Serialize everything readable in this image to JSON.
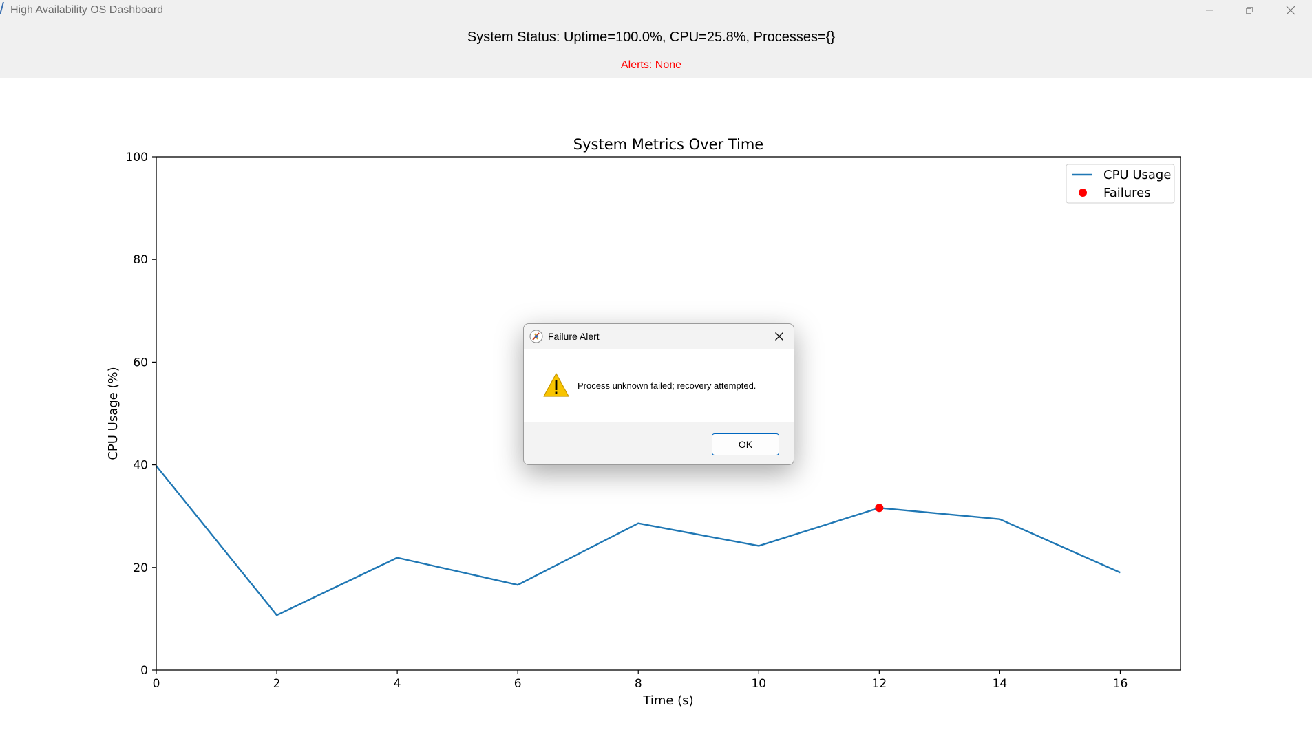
{
  "window": {
    "title": "High Availability OS Dashboard",
    "controls": {
      "minimize": "minimize-icon",
      "maximize": "restore-icon",
      "close": "close-icon"
    }
  },
  "status": {
    "text": "System Status: Uptime=100.0%, CPU=25.8%, Processes={}",
    "alerts": "Alerts: None",
    "alert_color": "#ff0000"
  },
  "chart_data": {
    "type": "line",
    "title": "System Metrics Over Time",
    "xlabel": "Time (s)",
    "ylabel": "CPU Usage (%)",
    "xlim": [
      0,
      17.0
    ],
    "ylim": [
      0,
      100
    ],
    "xticks": [
      0,
      2,
      4,
      6,
      8,
      10,
      12,
      14,
      16
    ],
    "yticks": [
      0,
      20,
      40,
      60,
      80,
      100
    ],
    "grid": false,
    "legend_position": "top-right",
    "series": [
      {
        "name": "CPU Usage",
        "kind": "line",
        "color": "#1f77b4",
        "x": [
          0,
          2,
          4,
          6,
          8,
          10,
          12,
          14,
          16
        ],
        "y": [
          39.8,
          10.7,
          21.9,
          16.6,
          28.6,
          24.2,
          31.6,
          29.4,
          19.0
        ]
      },
      {
        "name": "Failures",
        "kind": "marker",
        "color": "#ff0000",
        "x": [
          12
        ],
        "y": [
          31.6
        ]
      }
    ]
  },
  "dialog": {
    "title": "Failure Alert",
    "title_icon": "app-feather-icon",
    "message": "Process unknown failed; recovery attempted.",
    "icon": "warning-icon",
    "ok_label": "OK",
    "close_icon": "close-icon"
  }
}
